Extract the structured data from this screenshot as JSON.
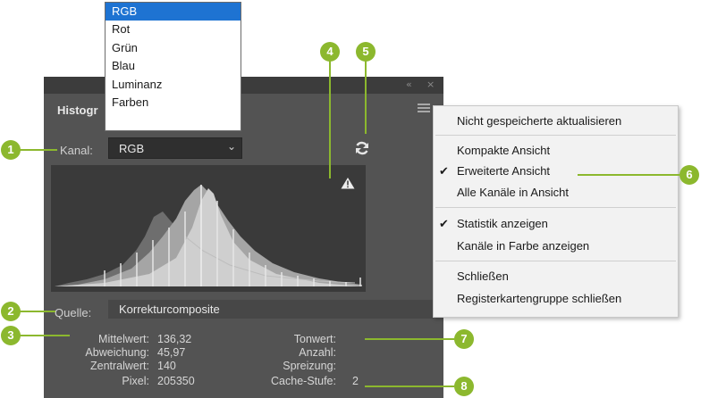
{
  "panel": {
    "title": "Histogr",
    "kanal_label": "Kanal:",
    "kanal_value": "RGB",
    "quelle_label": "Quelle:",
    "quelle_value": "Korrekturcomposite",
    "win_minimize": "«",
    "win_close": "×"
  },
  "stats": {
    "mittelwert_label": "Mittelwert:",
    "mittelwert_value": "136,32",
    "abweichung_label": "Abweichung:",
    "abweichung_value": "45,97",
    "zentralwert_label": "Zentralwert:",
    "zentralwert_value": "140",
    "pixel_label": "Pixel:",
    "pixel_value": "205350",
    "tonwert_label": "Tonwert:",
    "anzahl_label": "Anzahl:",
    "spreizung_label": "Spreizung:",
    "cache_label": "Cache-Stufe:",
    "cache_value": "2"
  },
  "dropdown": {
    "items": [
      "RGB",
      "Rot",
      "Grün",
      "Blau",
      "Luminanz",
      "Farben"
    ],
    "selected": "RGB"
  },
  "menu": {
    "items": [
      "Nicht gespeicherte aktualisieren",
      "Kompakte Ansicht",
      "Erweiterte Ansicht",
      "Alle Kanäle in Ansicht",
      "Statistik anzeigen",
      "Kanäle in Farbe anzeigen",
      "Schließen",
      "Registerkartengruppe schließen"
    ],
    "checked": [
      "Erweiterte Ansicht",
      "Statistik anzeigen"
    ],
    "check_glyph": "✔"
  },
  "callouts": [
    "1",
    "2",
    "3",
    "4",
    "5",
    "6",
    "7",
    "8"
  ],
  "icons": {
    "refresh": "refresh-icon",
    "warning": "warning-icon",
    "menu": "panel-menu-icon",
    "chevron": "⌄"
  },
  "colors": {
    "panel_bg": "#535353",
    "callout": "#8cb82e",
    "selection": "#1e73d2"
  }
}
